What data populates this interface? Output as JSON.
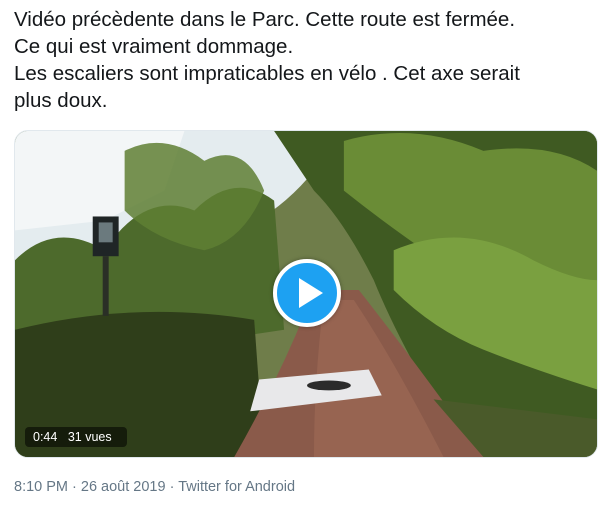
{
  "tweet": {
    "lines": [
      "Vidéo précèdente dans le Parc. Cette route est fermée.",
      "Ce qui est vraiment dommage.",
      "Les escaliers sont impraticables en vélo . Cet axe serait",
      "plus doux."
    ]
  },
  "video": {
    "duration": "0:44",
    "views": "31 vues",
    "play_icon": "play-icon"
  },
  "meta": {
    "time": "8:10 PM",
    "separator": " · ",
    "date": "26 août 2019",
    "source": "Twitter for Android"
  }
}
